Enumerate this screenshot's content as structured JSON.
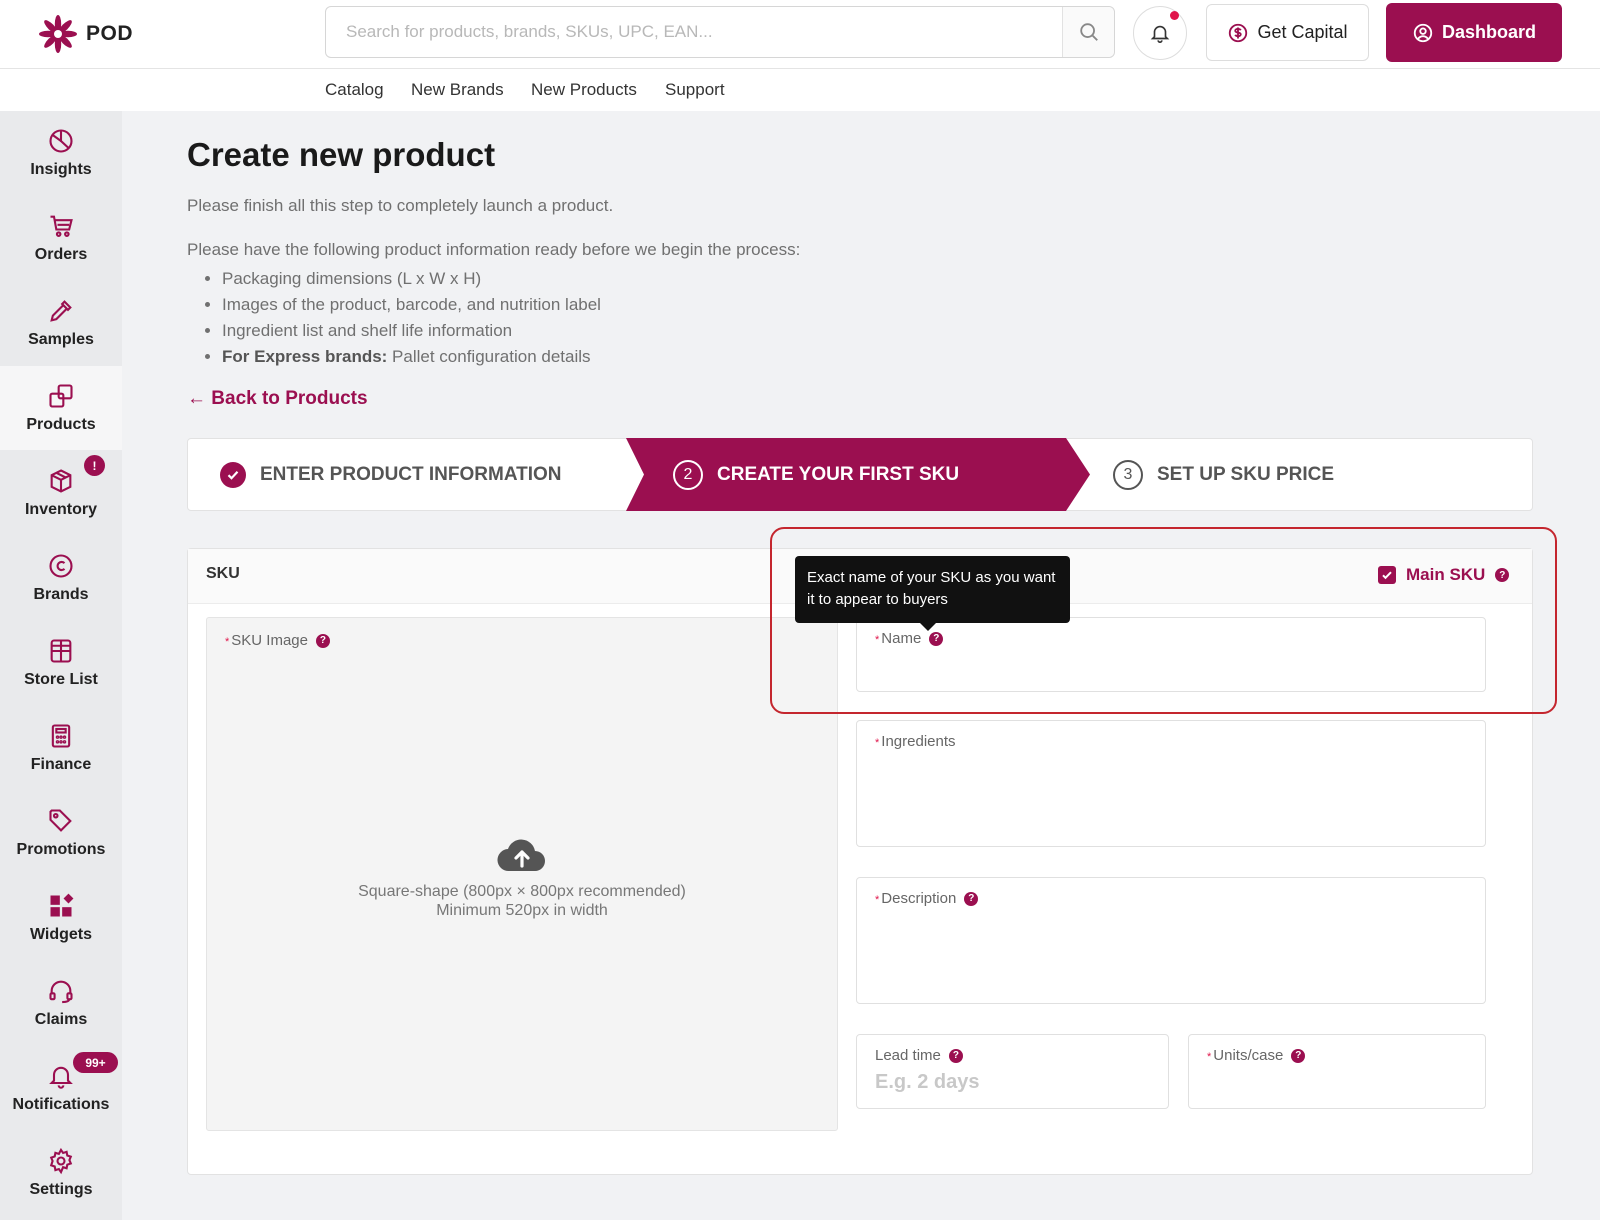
{
  "brand": {
    "name": "POD",
    "accent": "#9b0f50"
  },
  "search": {
    "placeholder": "Search for products, brands, SKUs, UPC, EAN..."
  },
  "header": {
    "capital_label": "Get Capital",
    "dashboard_label": "Dashboard"
  },
  "subnav": [
    "Catalog",
    "New Brands",
    "New Products",
    "Support"
  ],
  "sidebar": {
    "items": [
      {
        "label": "Insights",
        "icon": "pie-chart-icon"
      },
      {
        "label": "Orders",
        "icon": "cart-icon"
      },
      {
        "label": "Samples",
        "icon": "pipette-icon"
      },
      {
        "label": "Products",
        "icon": "copy-icon"
      },
      {
        "label": "Inventory",
        "icon": "box-icon"
      },
      {
        "label": "Brands",
        "icon": "copyright-icon"
      },
      {
        "label": "Store List",
        "icon": "store-icon"
      },
      {
        "label": "Finance",
        "icon": "calculator-icon"
      },
      {
        "label": "Promotions",
        "icon": "tag-icon"
      },
      {
        "label": "Widgets",
        "icon": "widgets-icon"
      },
      {
        "label": "Claims",
        "icon": "headset-icon"
      },
      {
        "label": "Notifications",
        "icon": "bell-icon"
      },
      {
        "label": "Settings",
        "icon": "gear-icon"
      }
    ],
    "inventory_badge": "!",
    "notifications_badge": "99+"
  },
  "page": {
    "title": "Create new product",
    "intro": "Please finish all this step to completely launch a product.",
    "intro2": "Please have the following product information ready before we begin the process:",
    "bullets": [
      "Packaging dimensions (L x W x H)",
      "Images of the product, barcode, and nutrition label",
      "Ingredient list and shelf life information"
    ],
    "express_bold": "For Express brands:",
    "express_rest": " Pallet configuration details",
    "back_link": "← Back to Products"
  },
  "stepper": {
    "step1": "ENTER PRODUCT INFORMATION",
    "step2": "CREATE YOUR FIRST SKU",
    "step2_num": "2",
    "step3": "SET UP SKU PRICE",
    "step3_num": "3"
  },
  "sku_card": {
    "header": "SKU",
    "main_sku_label": "Main SKU",
    "image_label": "SKU Image",
    "upload_hint1": "Square-shape (800px × 800px recommended)",
    "upload_hint2": "Minimum 520px in width",
    "name_label": "Name",
    "ingredients_label": "Ingredients",
    "description_label": "Description",
    "lead_time_label": "Lead time",
    "lead_time_placeholder": "E.g. 2 days",
    "units_case_label": "Units/case",
    "tooltip": "Exact name of your SKU as you want it to appear to buyers"
  }
}
